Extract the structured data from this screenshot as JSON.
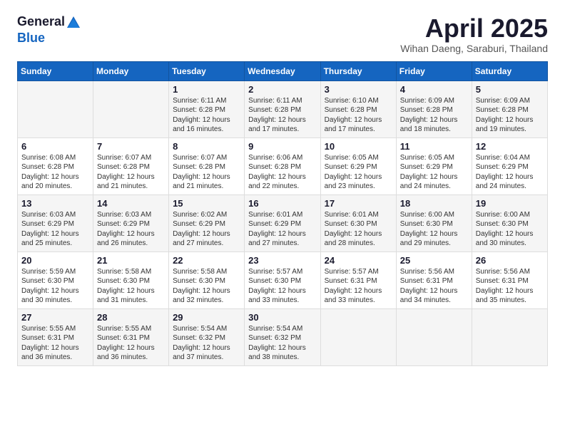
{
  "header": {
    "logo_general": "General",
    "logo_blue": "Blue",
    "month_year": "April 2025",
    "location": "Wihan Daeng, Saraburi, Thailand"
  },
  "days_of_week": [
    "Sunday",
    "Monday",
    "Tuesday",
    "Wednesday",
    "Thursday",
    "Friday",
    "Saturday"
  ],
  "weeks": [
    [
      {
        "day": "",
        "info": ""
      },
      {
        "day": "",
        "info": ""
      },
      {
        "day": "1",
        "info": "Sunrise: 6:11 AM\nSunset: 6:28 PM\nDaylight: 12 hours and 16 minutes."
      },
      {
        "day": "2",
        "info": "Sunrise: 6:11 AM\nSunset: 6:28 PM\nDaylight: 12 hours and 17 minutes."
      },
      {
        "day": "3",
        "info": "Sunrise: 6:10 AM\nSunset: 6:28 PM\nDaylight: 12 hours and 17 minutes."
      },
      {
        "day": "4",
        "info": "Sunrise: 6:09 AM\nSunset: 6:28 PM\nDaylight: 12 hours and 18 minutes."
      },
      {
        "day": "5",
        "info": "Sunrise: 6:09 AM\nSunset: 6:28 PM\nDaylight: 12 hours and 19 minutes."
      }
    ],
    [
      {
        "day": "6",
        "info": "Sunrise: 6:08 AM\nSunset: 6:28 PM\nDaylight: 12 hours and 20 minutes."
      },
      {
        "day": "7",
        "info": "Sunrise: 6:07 AM\nSunset: 6:28 PM\nDaylight: 12 hours and 21 minutes."
      },
      {
        "day": "8",
        "info": "Sunrise: 6:07 AM\nSunset: 6:28 PM\nDaylight: 12 hours and 21 minutes."
      },
      {
        "day": "9",
        "info": "Sunrise: 6:06 AM\nSunset: 6:28 PM\nDaylight: 12 hours and 22 minutes."
      },
      {
        "day": "10",
        "info": "Sunrise: 6:05 AM\nSunset: 6:29 PM\nDaylight: 12 hours and 23 minutes."
      },
      {
        "day": "11",
        "info": "Sunrise: 6:05 AM\nSunset: 6:29 PM\nDaylight: 12 hours and 24 minutes."
      },
      {
        "day": "12",
        "info": "Sunrise: 6:04 AM\nSunset: 6:29 PM\nDaylight: 12 hours and 24 minutes."
      }
    ],
    [
      {
        "day": "13",
        "info": "Sunrise: 6:03 AM\nSunset: 6:29 PM\nDaylight: 12 hours and 25 minutes."
      },
      {
        "day": "14",
        "info": "Sunrise: 6:03 AM\nSunset: 6:29 PM\nDaylight: 12 hours and 26 minutes."
      },
      {
        "day": "15",
        "info": "Sunrise: 6:02 AM\nSunset: 6:29 PM\nDaylight: 12 hours and 27 minutes."
      },
      {
        "day": "16",
        "info": "Sunrise: 6:01 AM\nSunset: 6:29 PM\nDaylight: 12 hours and 27 minutes."
      },
      {
        "day": "17",
        "info": "Sunrise: 6:01 AM\nSunset: 6:30 PM\nDaylight: 12 hours and 28 minutes."
      },
      {
        "day": "18",
        "info": "Sunrise: 6:00 AM\nSunset: 6:30 PM\nDaylight: 12 hours and 29 minutes."
      },
      {
        "day": "19",
        "info": "Sunrise: 6:00 AM\nSunset: 6:30 PM\nDaylight: 12 hours and 30 minutes."
      }
    ],
    [
      {
        "day": "20",
        "info": "Sunrise: 5:59 AM\nSunset: 6:30 PM\nDaylight: 12 hours and 30 minutes."
      },
      {
        "day": "21",
        "info": "Sunrise: 5:58 AM\nSunset: 6:30 PM\nDaylight: 12 hours and 31 minutes."
      },
      {
        "day": "22",
        "info": "Sunrise: 5:58 AM\nSunset: 6:30 PM\nDaylight: 12 hours and 32 minutes."
      },
      {
        "day": "23",
        "info": "Sunrise: 5:57 AM\nSunset: 6:30 PM\nDaylight: 12 hours and 33 minutes."
      },
      {
        "day": "24",
        "info": "Sunrise: 5:57 AM\nSunset: 6:31 PM\nDaylight: 12 hours and 33 minutes."
      },
      {
        "day": "25",
        "info": "Sunrise: 5:56 AM\nSunset: 6:31 PM\nDaylight: 12 hours and 34 minutes."
      },
      {
        "day": "26",
        "info": "Sunrise: 5:56 AM\nSunset: 6:31 PM\nDaylight: 12 hours and 35 minutes."
      }
    ],
    [
      {
        "day": "27",
        "info": "Sunrise: 5:55 AM\nSunset: 6:31 PM\nDaylight: 12 hours and 36 minutes."
      },
      {
        "day": "28",
        "info": "Sunrise: 5:55 AM\nSunset: 6:31 PM\nDaylight: 12 hours and 36 minutes."
      },
      {
        "day": "29",
        "info": "Sunrise: 5:54 AM\nSunset: 6:32 PM\nDaylight: 12 hours and 37 minutes."
      },
      {
        "day": "30",
        "info": "Sunrise: 5:54 AM\nSunset: 6:32 PM\nDaylight: 12 hours and 38 minutes."
      },
      {
        "day": "",
        "info": ""
      },
      {
        "day": "",
        "info": ""
      },
      {
        "day": "",
        "info": ""
      }
    ]
  ]
}
